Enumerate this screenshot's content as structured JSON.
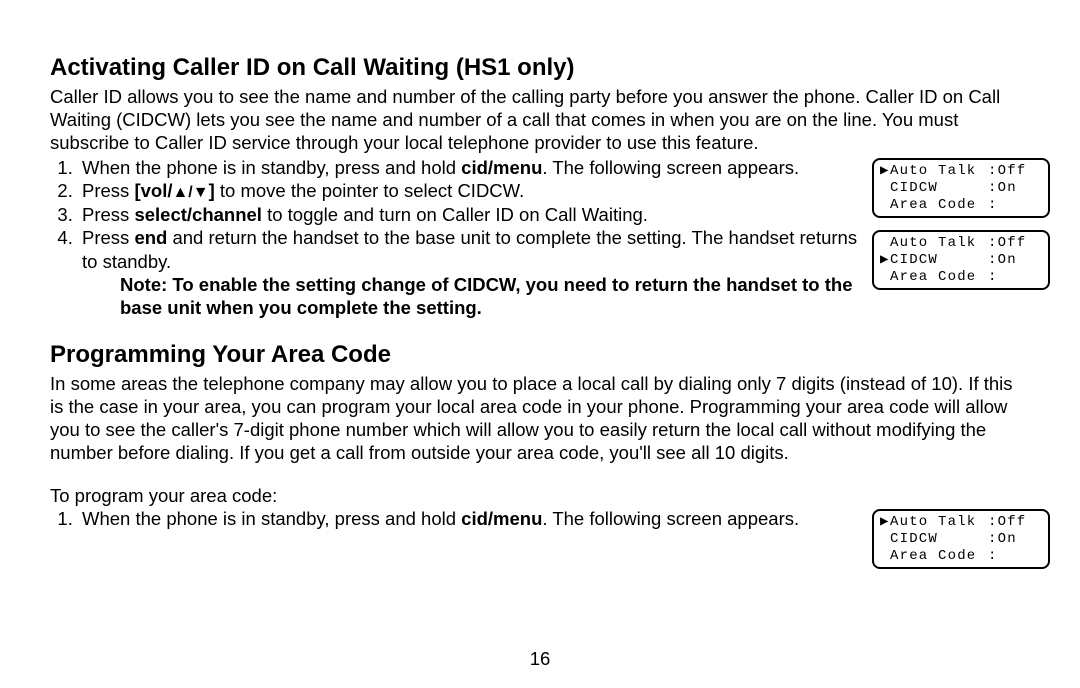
{
  "page_number": "16",
  "section1": {
    "heading": "Activating Caller ID on Call Waiting (HS1 only)",
    "intro": "Caller ID allows you to see the name and number of the calling party before you answer the phone. Caller ID on Call Waiting (CIDCW) lets you see the name and number of a call that comes in when you are on the line. You must subscribe to Caller ID service through your local telephone provider to use this feature.",
    "steps": {
      "s1_a": "When the phone is in standby, press and hold ",
      "s1_b": "cid/menu",
      "s1_c": ". The following screen appears.",
      "s2_a": "Press ",
      "s2_b": "[vol/",
      "s2_arrows": "▲/▼",
      "s2_b2": "]",
      "s2_c": " to move the pointer to select CIDCW.",
      "s3_a": "Press ",
      "s3_b": "select/channel",
      "s3_c": " to toggle and turn on Caller ID on Call Waiting.",
      "s4_a": "Press ",
      "s4_b": "end",
      "s4_c": " and return the handset to the base unit to complete the setting. The handset returns to standby."
    },
    "note": "Note: To enable the setting change of CIDCW, you need to return the handset to the base unit when you complete the setting.",
    "screens": {
      "a": {
        "pointer_row": 0,
        "rows": [
          {
            "label": "Auto Talk",
            "value": "Off"
          },
          {
            "label": "CIDCW",
            "value": "On"
          },
          {
            "label": "Area Code",
            "value": ""
          }
        ]
      },
      "b": {
        "pointer_row": 1,
        "rows": [
          {
            "label": "Auto Talk",
            "value": "Off"
          },
          {
            "label": "CIDCW",
            "value": "On"
          },
          {
            "label": "Area Code",
            "value": ""
          }
        ]
      }
    }
  },
  "section2": {
    "heading": "Programming Your Area Code",
    "intro": "In some areas the telephone company may allow you to place a local call by dialing only 7 digits (instead of 10). If this is the case in your area, you can program your local area code in your phone. Programming your area code will allow you to see the caller's 7-digit phone number which will allow you to easily return the local call without modifying the number before dialing. If you get a call from outside your area code, you'll see all 10 digits.",
    "lead": "To program your area code:",
    "steps": {
      "s1_a": "When the phone is in standby, press and hold ",
      "s1_b": "cid/menu",
      "s1_c": ". The following screen appears."
    },
    "screen": {
      "pointer_row": 0,
      "rows": [
        {
          "label": "Auto Talk",
          "value": "Off"
        },
        {
          "label": "CIDCW",
          "value": "On"
        },
        {
          "label": "Area Code",
          "value": ""
        }
      ]
    }
  }
}
